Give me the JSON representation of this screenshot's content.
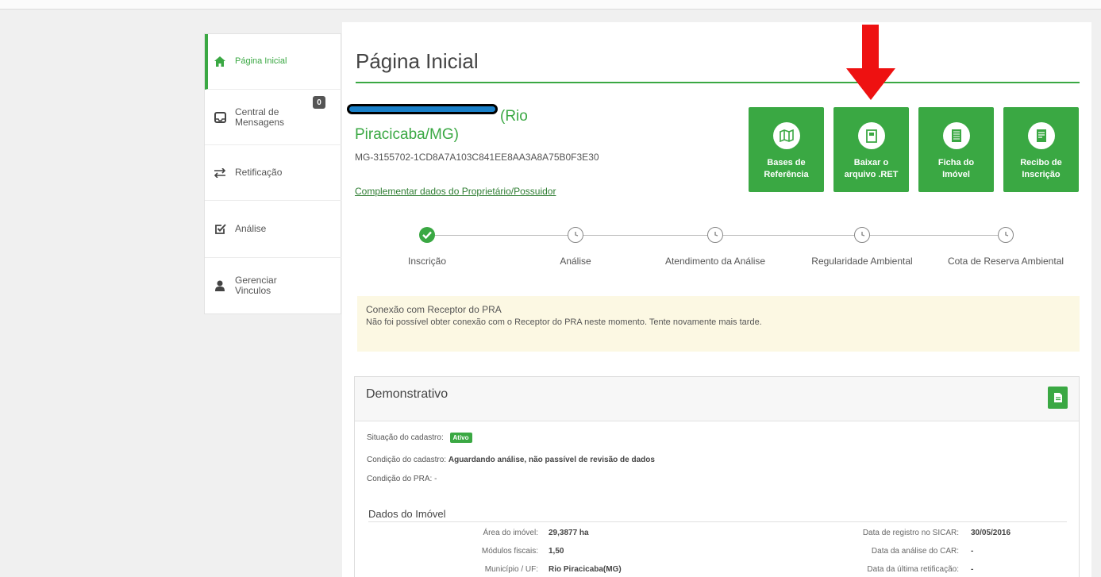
{
  "sidebar": {
    "items": [
      {
        "label": "Página Inicial",
        "icon": "home-icon"
      },
      {
        "label_line1": "Central de",
        "label_line2": "Mensagens",
        "badge": "0",
        "icon": "inbox-icon"
      },
      {
        "label": "Retificação",
        "icon": "swap-icon"
      },
      {
        "label": "Análise",
        "icon": "check-square-icon"
      },
      {
        "label_line1": "Gerenciar",
        "label_line2": "Vinculos",
        "icon": "user-icon"
      }
    ]
  },
  "header": {
    "title": "Página Inicial"
  },
  "property": {
    "location_part1": "(Rio",
    "location_part2": "Piracicaba/MG)",
    "code": "MG-3155702-1CD8A7A103C841EE8AA3A8A75B0F3E30",
    "link_text": "Complementar dados do Proprietário/Possuidor"
  },
  "actions": [
    {
      "line1": "Bases de",
      "line2": "Referência",
      "icon": "map-icon"
    },
    {
      "line1": "Baixar o",
      "line2": "arquivo .RET",
      "icon": "file-download-icon"
    },
    {
      "line1": "Ficha do",
      "line2": "Imóvel",
      "icon": "document-icon"
    },
    {
      "line1": "Recibo de",
      "line2": "Inscrição",
      "icon": "receipt-icon"
    }
  ],
  "steps": [
    {
      "label": "Inscrição",
      "status": "done"
    },
    {
      "label": "Análise",
      "status": "pending"
    },
    {
      "label": "Atendimento da Análise",
      "status": "pending"
    },
    {
      "label": "Regularidade Ambiental",
      "status": "pending"
    },
    {
      "label": "Cota de Reserva Ambiental",
      "status": "pending"
    }
  ],
  "alert": {
    "title": "Conexão com Receptor do PRA",
    "body": "Não foi possível obter conexão com o Receptor do PRA neste momento. Tente novamente mais tarde."
  },
  "demonstrativo": {
    "title": "Demonstrativo",
    "situacao_label": "Situação do cadastro:",
    "situacao_value": "Ativo",
    "condicao_label": "Condição do cadastro:",
    "condicao_value": "Aguardando análise, não passível de revisão de dados",
    "pra_label": "Condição do PRA:",
    "pra_value": "-",
    "section_title": "Dados do Imóvel",
    "left_fields": [
      {
        "label": "Área do imóvel:",
        "value": "29,3877 ha"
      },
      {
        "label": "Módulos fiscais:",
        "value": "1,50"
      },
      {
        "label": "Município / UF:",
        "value": "Rio Piracicaba(MG)"
      }
    ],
    "right_fields": [
      {
        "label": "Data de registro no SICAR:",
        "value": "30/05/2016"
      },
      {
        "label": "Data da análise do CAR:",
        "value": "-"
      },
      {
        "label": "Data da última retificação:",
        "value": "-"
      }
    ]
  },
  "colors": {
    "accent": "#3aa843",
    "alert_bg": "#fcf8e3",
    "arrow": "#ee1111",
    "redaction": "#1a80c8"
  }
}
